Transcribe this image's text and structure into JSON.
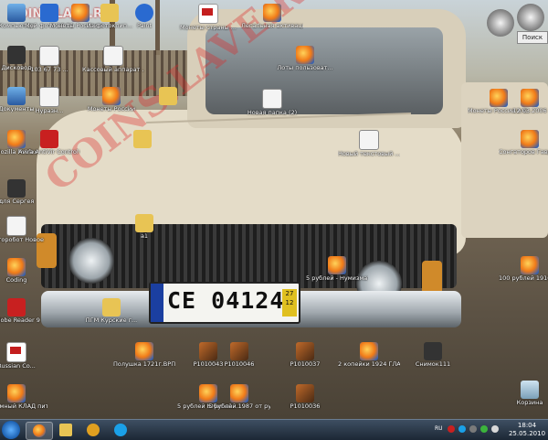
{
  "watermark": {
    "top": "COINS.LAVE.RU",
    "diagonal": "COINS.LAVE.RU"
  },
  "plate": {
    "number": "CE 04124",
    "sticker": "27 12"
  },
  "icons": {
    "i1": "Компьютер",
    "i2": "Мой фото 10.11",
    "i3": "Монеты России и ...",
    "i4": "Из фотоклип...",
    "i5": "Paint",
    "i6": "Монеты страны ...",
    "i7": "Легальная активация ...",
    "i8": "Дисковод",
    "i9": "103 67 73 ...",
    "i10": "Кассовый аппарат ...",
    "i11": "Лоты пользоват...",
    "i12": "Документы",
    "i13": "Нуразн...",
    "i14": "Монеты России",
    "i15": "Новая папка (2)",
    "i16": "Монеты России и С...",
    "i17": "12.03.2006",
    "i18": "Mozilla Firefox",
    "i19": "Avira AntiVir Control Ce...",
    "i20": "Новый текстовый ...",
    "i21": "Сонгаторов Гавриил С...",
    "i22": "для Сергея",
    "i23": "a1",
    "i24": "Фоторобот Новое",
    "i25": "Coding",
    "i26": "5 рублей - Нумизмат...",
    "i27": "100 рублей 1910 - 21.8...",
    "i28": "Adobe Reader 9",
    "i29": "ПГМ Курские г...",
    "i30": "Russian Co...",
    "i31": "Полушка 1721г.ВРП...",
    "i32": "P1010043",
    "i33": "P1010046",
    "i34": "P1010037",
    "i35": "2 копейки 1924 ГЛАД...",
    "i36": "Снимок111",
    "i37": "огромный КЛАД пить...",
    "i38": "5 рублей Юбилейн...",
    "i39": "5 рублей 1987 от ру...",
    "i40": "P1010036",
    "i41": "Корзина"
  },
  "gadget": {
    "button": "Поиск"
  },
  "taskbar": {
    "lang": "RU",
    "time": "18:04",
    "date": "25.05.2010"
  }
}
